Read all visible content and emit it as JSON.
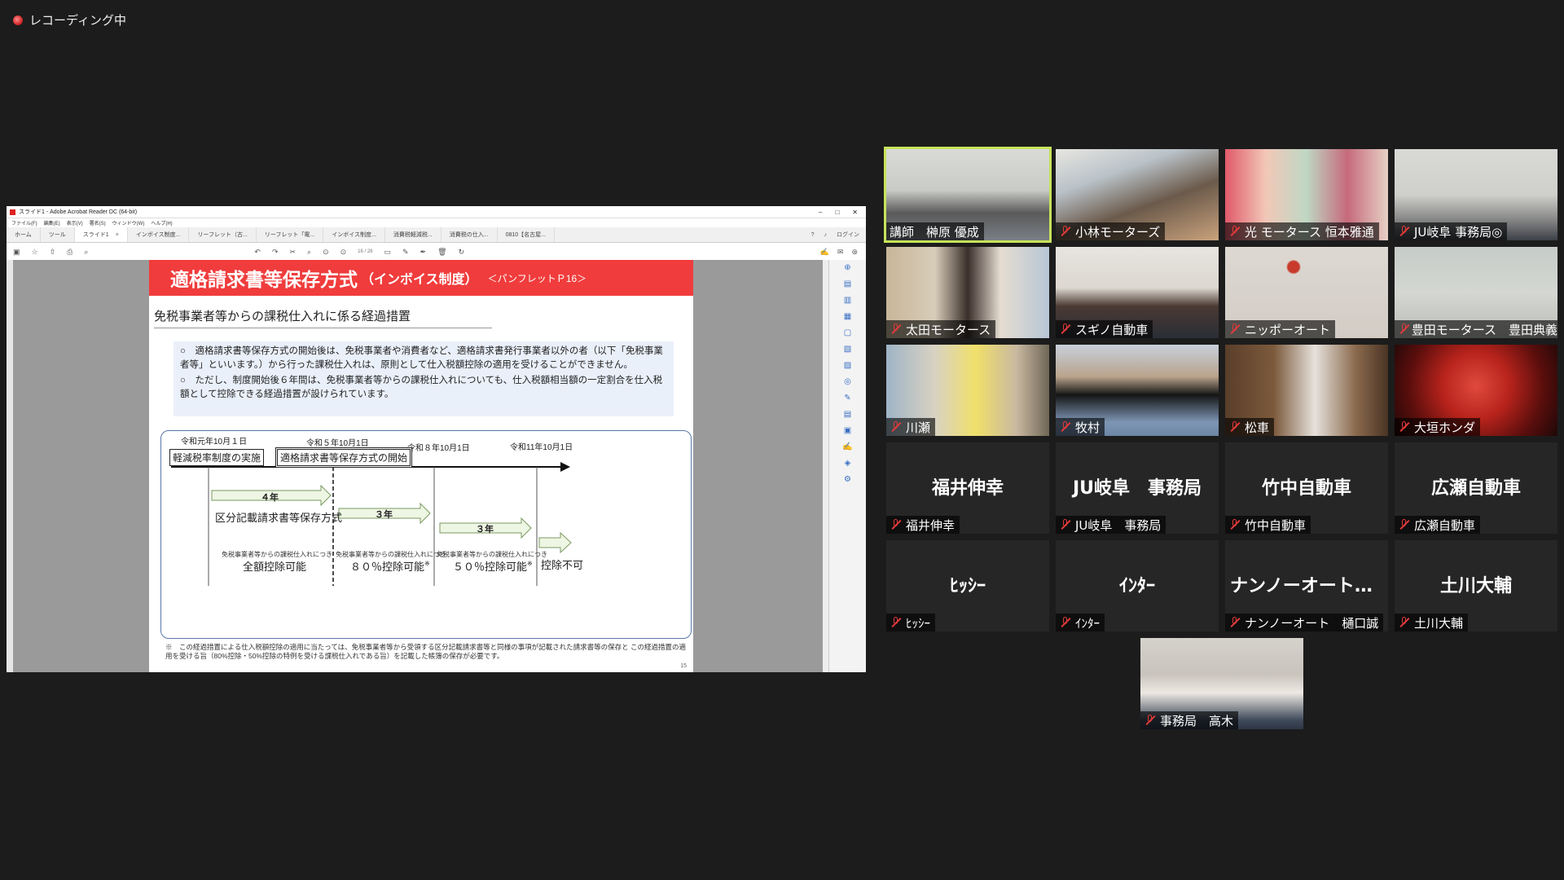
{
  "recording": {
    "label": "レコーディング中"
  },
  "acrobat": {
    "window_title": "スライド1 - Adobe Acrobat Reader DC (64-bit)",
    "menu": [
      "ファイル(F)",
      "編集(E)",
      "表示(V)",
      "署名(S)",
      "ウィンドウ(W)",
      "ヘルプ(H)"
    ],
    "tabs": [
      "ホーム",
      "ツール",
      "スライド1",
      "インボイス制度...",
      "リーフレット（古...",
      "リーフレット「電...",
      "インボイス制度...",
      "消費税軽減税...",
      "消費税の仕入...",
      "0810【名古屋..."
    ],
    "login_label": "ログイン",
    "page_indicator": "16 / 28",
    "slide": {
      "title": "適格請求書等保存方式",
      "title_paren": "（インボイス制度）",
      "title_ref": "＜パンフレットＰ16＞",
      "subheading": "免税事業者等からの課税仕入れに係る経過措置",
      "para1": "○　適格請求書等保存方式の開始後は、免税事業者や消費者など、適格請求書発行事業者以外の者（以下「免税事業者等」といいます。）から行った課税仕入れは、原則として仕入税額控除の適用を受けることができません。",
      "para2": "○　ただし、制度開始後６年間は、免税事業者等からの課税仕入れについても、仕入税額相当額の一定割合を仕入税額として控除できる経過措置が設けられています。",
      "dates": [
        "令和元年10月１日",
        "令和５年10月1日",
        "令和８年10月1日",
        "令和11年10月1日"
      ],
      "event1": "軽減税率制度の実施",
      "event2": "適格請求書等保存方式の開始",
      "arrow1": "４年",
      "arrow2": "３年",
      "arrow3": "３年",
      "phase1": "区分記載請求書等保存方式",
      "caption": "免税事業者等からの課税仕入れにつき",
      "result1": "全額控除可能",
      "result2": "８０％控除可能",
      "result3": "５０％控除可能",
      "result4": "控除不可",
      "note_mark": "※",
      "footnote": "※　この経過措置による仕入税額控除の適用に当たっては、免税事業者等から受領する区分記載請求書等と同様の事項が記載された請求書等の保存と この経過措置の適用を受ける旨（80%控除・50%控除の特例を受ける課税仕入れである旨）を記載した帳簿の保存が必要です。",
      "page_number": "15"
    }
  },
  "participants": [
    {
      "name": "講師　榊原 優成",
      "video": true,
      "active": true,
      "muted": false
    },
    {
      "name": "小林モーターズ",
      "video": true,
      "muted": true
    },
    {
      "name": "光 モータース 恒本雅通",
      "video": true,
      "muted": true
    },
    {
      "name": "JU岐阜 事務局◎",
      "video": true,
      "muted": true
    },
    {
      "name": "太田モータース",
      "video": true,
      "muted": true
    },
    {
      "name": "スギノ自動車",
      "video": true,
      "muted": true
    },
    {
      "name": "ニッポーオート",
      "video": true,
      "muted": true
    },
    {
      "name": "豊田モータース　豊田典義",
      "video": true,
      "muted": true
    },
    {
      "name": "川瀬",
      "video": true,
      "muted": true
    },
    {
      "name": "牧村",
      "video": true,
      "muted": true
    },
    {
      "name": "松車",
      "video": true,
      "muted": true
    },
    {
      "name": "大垣ホンダ",
      "video": true,
      "muted": true
    },
    {
      "name": "福井伸幸",
      "display": "福井伸幸",
      "video": false,
      "muted": true
    },
    {
      "name": "JU岐阜　事務局",
      "display": "JU岐阜　事務局",
      "video": false,
      "muted": true
    },
    {
      "name": "竹中自動車",
      "display": "竹中自動車",
      "video": false,
      "muted": true
    },
    {
      "name": "広瀬自動車",
      "display": "広瀬自動車",
      "video": false,
      "muted": true
    },
    {
      "name": "ﾋｯｼｰ",
      "display": "ﾋｯｼｰ",
      "video": false,
      "muted": true
    },
    {
      "name": "ｲﾝﾀｰ",
      "display": "ｲﾝﾀｰ",
      "video": false,
      "muted": true
    },
    {
      "name": "ナンノーオート　樋口誠",
      "display": "ナンノーオート　樋...",
      "video": false,
      "muted": true
    },
    {
      "name": "土川大輔",
      "display": "土川大輔",
      "video": false,
      "muted": true
    },
    {
      "name": "事務局　高木",
      "video": true,
      "muted": true
    }
  ]
}
